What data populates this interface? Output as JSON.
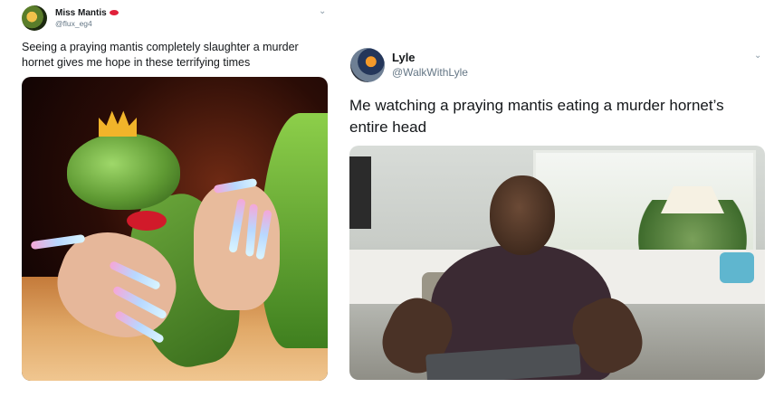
{
  "tweets": [
    {
      "display_name": "Miss Mantis",
      "handle": "@flux_eg4",
      "text": "Seeing a praying mantis completely slaughter a murder hornet gives me hope in these terrifying times",
      "chevron_icon": "chevron-down-icon"
    },
    {
      "display_name": "Lyle",
      "handle": "@WalkWithLyle",
      "text": "Me watching a praying mantis eating a murder hornet’s entire head",
      "chevron_icon": "chevron-down-icon"
    }
  ],
  "colors": {
    "handle": "#657786",
    "text": "#14171a",
    "lips_emoji": "#e0203a"
  }
}
